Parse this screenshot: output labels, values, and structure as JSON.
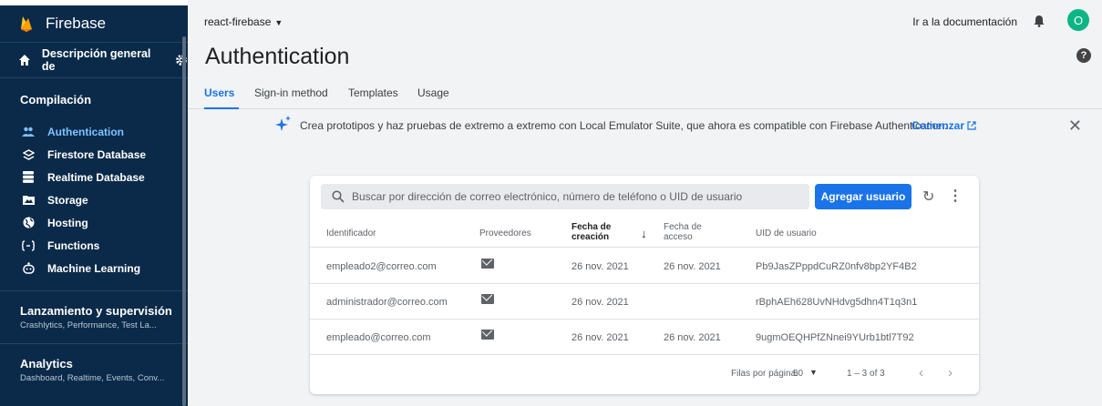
{
  "sidebar": {
    "brand": "Firebase",
    "project_overview": "Descripción general de",
    "section_build": "Compilación",
    "items": [
      {
        "label": "Authentication",
        "icon": "people-icon"
      },
      {
        "label": "Firestore Database",
        "icon": "firestore-icon"
      },
      {
        "label": "Realtime Database",
        "icon": "database-icon"
      },
      {
        "label": "Storage",
        "icon": "photo-folder-icon"
      },
      {
        "label": "Hosting",
        "icon": "globe-icon"
      },
      {
        "label": "Functions",
        "icon": "functions-icon"
      },
      {
        "label": "Machine Learning",
        "icon": "robot-icon"
      }
    ],
    "release": {
      "title": "Lanzamiento y supervisión",
      "subtitle": "Crashlytics, Performance, Test La..."
    },
    "analytics": {
      "title": "Analytics",
      "subtitle": "Dashboard, Realtime, Events, Conv..."
    }
  },
  "topbar": {
    "project": "react-firebase",
    "docs": "Ir a la documentación",
    "avatar": "O"
  },
  "page": {
    "title": "Authentication",
    "help": "?",
    "tabs": [
      "Users",
      "Sign-in method",
      "Templates",
      "Usage"
    ]
  },
  "banner": {
    "text": "Crea prototipos y haz pruebas de extremo a extremo con Local Emulator Suite, que ahora es compatible con Firebase Authentication.",
    "link": "Comenzar",
    "close": "✕"
  },
  "users": {
    "search_placeholder": "Buscar por dirección de correo electrónico, número de teléfono o UID de usuario",
    "add_button": "Agregar usuario",
    "columns": {
      "identifier": "Identificador",
      "providers": "Proveedores",
      "created_1": "Fecha de",
      "created_2": "creación",
      "signed_in_1": "Fecha de",
      "signed_in_2": "acceso",
      "uid": "UID de usuario"
    },
    "rows": [
      {
        "identifier": "empleado2@correo.com",
        "created": "26 nov. 2021",
        "signed_in": "26 nov. 2021",
        "uid": "Pb9JasZPppdCuRZ0nfv8bp2YF4B2"
      },
      {
        "identifier": "administrador@correo.com",
        "created": "26 nov. 2021",
        "signed_in": "",
        "uid": "rBphAEh628UvNHdvg5dhn4T1q3n1"
      },
      {
        "identifier": "empleado@correo.com",
        "created": "26 nov. 2021",
        "signed_in": "26 nov. 2021",
        "uid": "9ugmOEQHPfZNnei9YUrb1btl7T92"
      }
    ],
    "footer": {
      "rows_per_page_label": "Filas por página:",
      "rows_per_page": "50",
      "range": "1 – 3 of 3"
    }
  },
  "colors": {
    "sidebar": "#0b2a4a",
    "accent": "#1a73e8",
    "active_nav": "#7cc3ff",
    "avatar": "#0bb585"
  }
}
